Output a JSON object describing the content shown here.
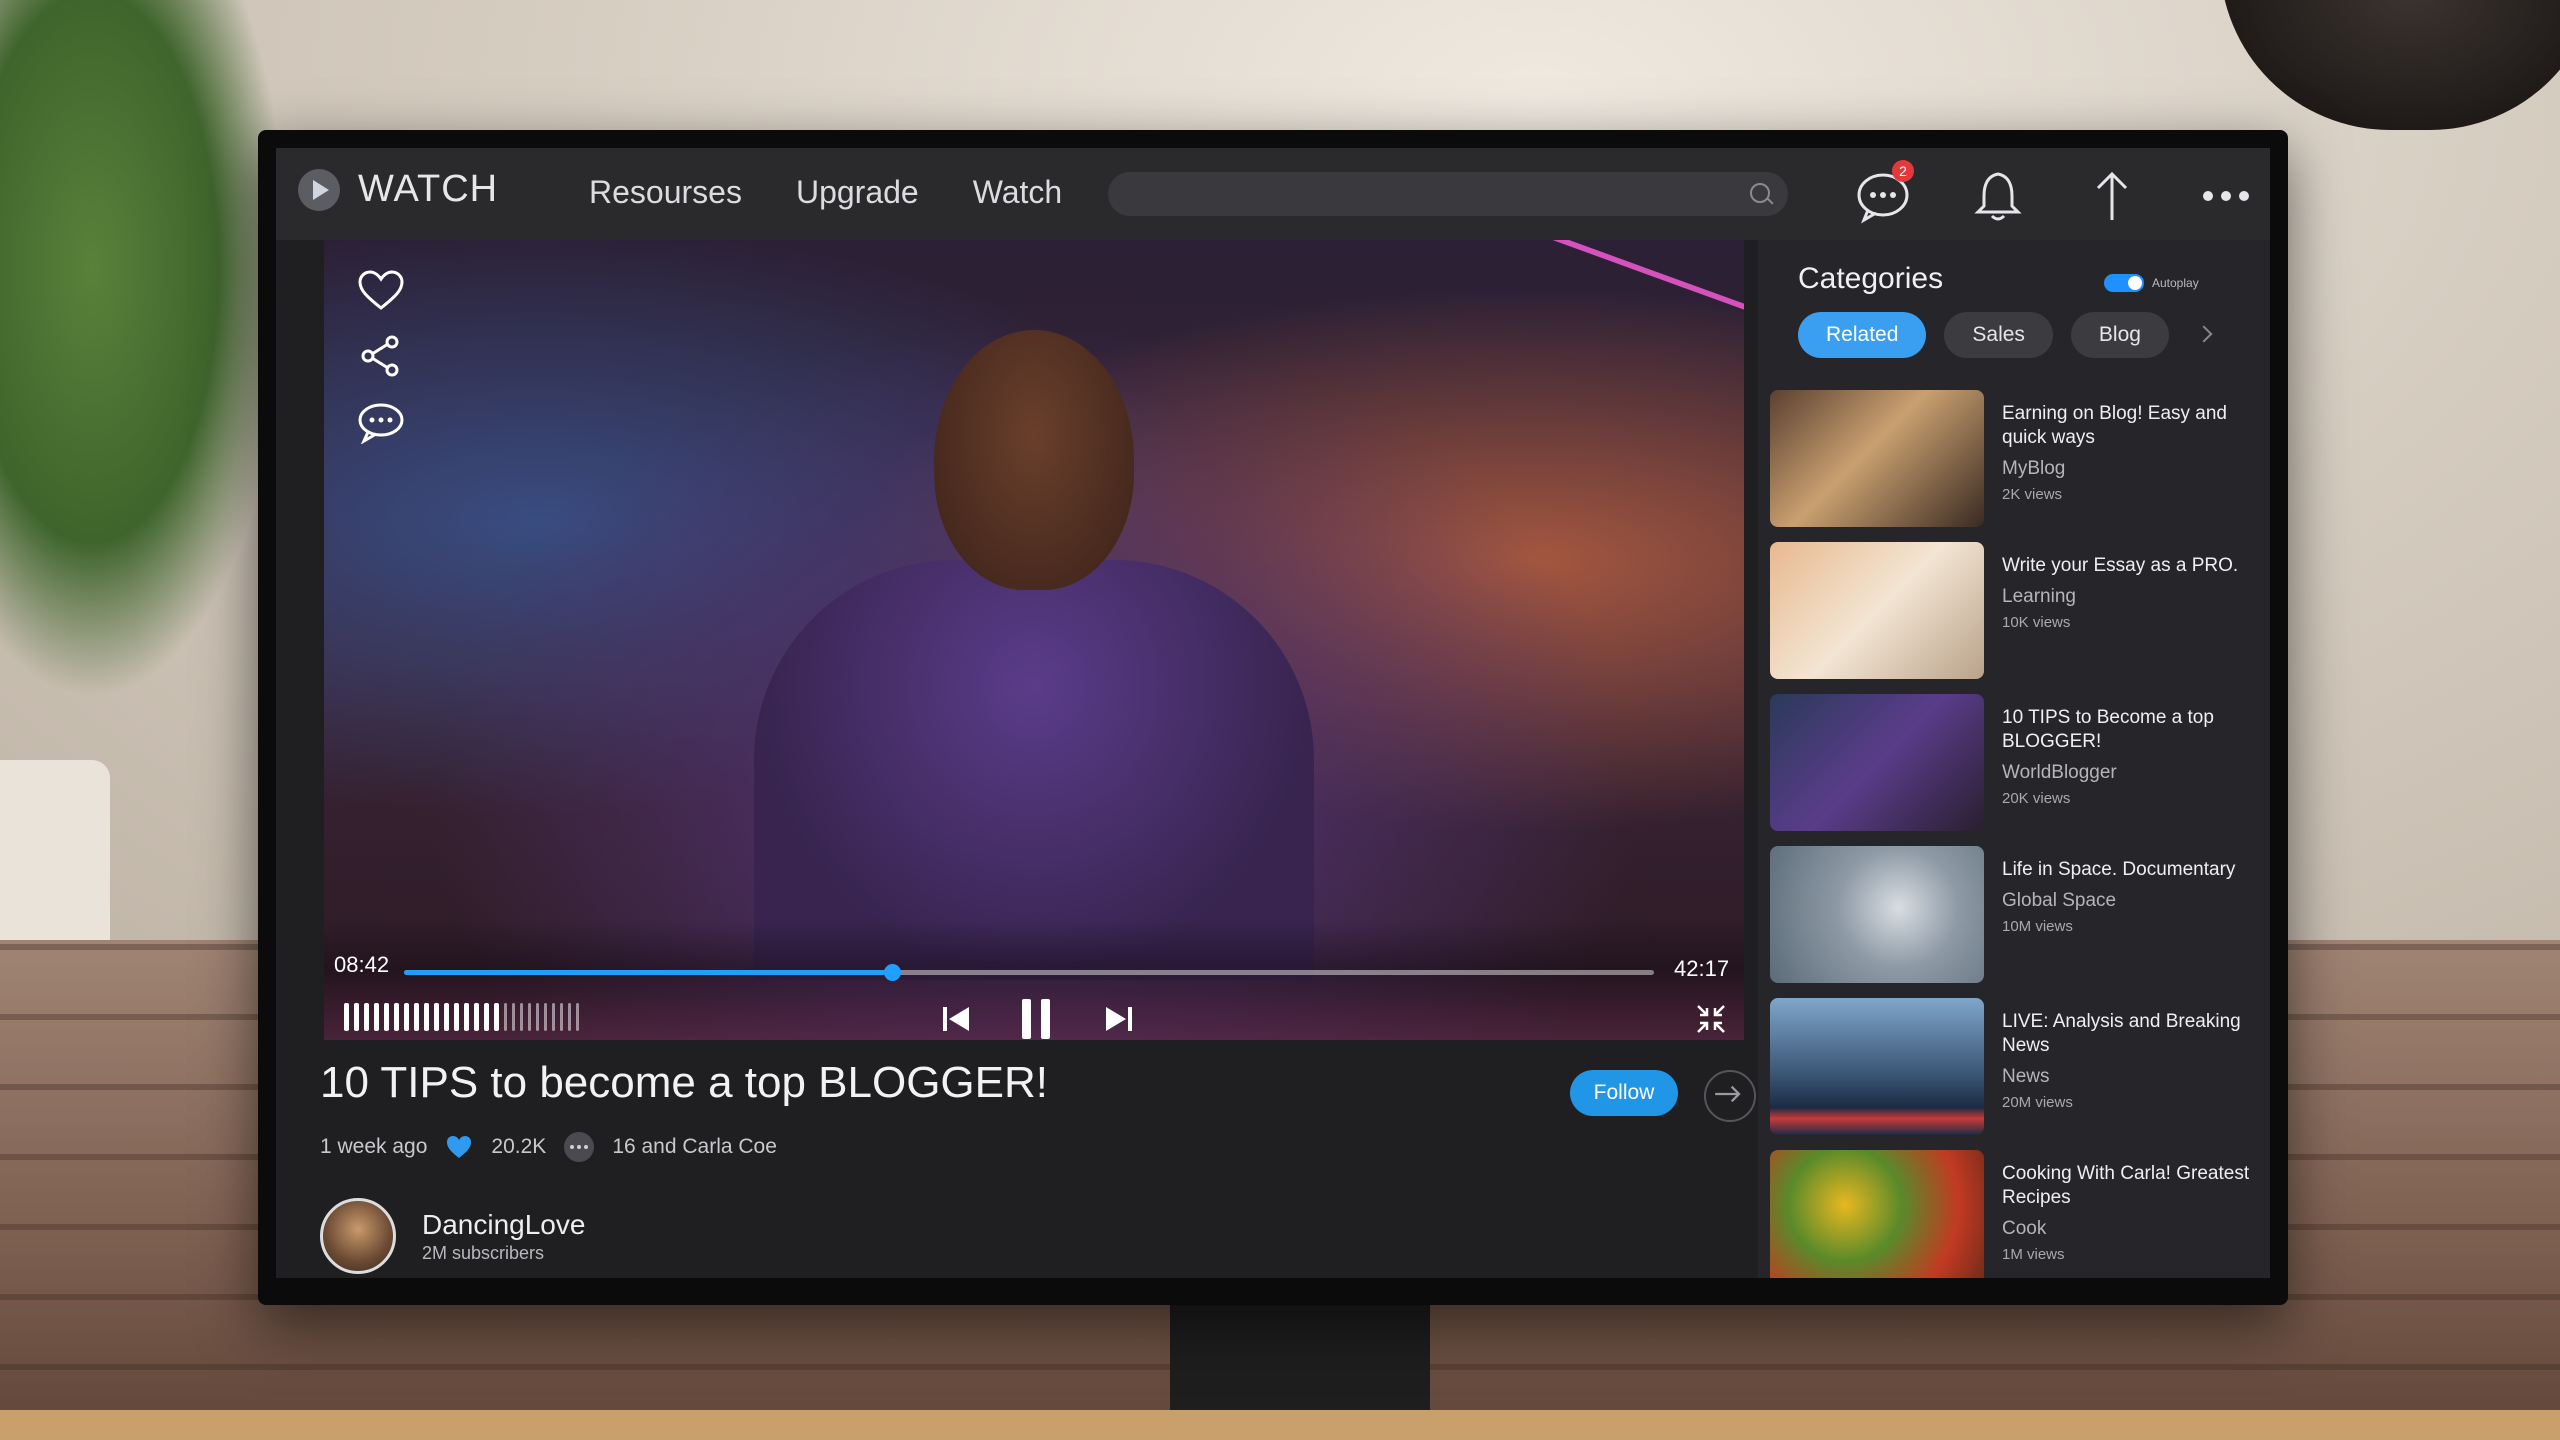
{
  "nav": {
    "logo": "WATCH",
    "menu": [
      "Resourses",
      "Upgrade",
      "Watch"
    ],
    "search_placeholder": "",
    "chat_badge": "2",
    "accent": "#1ea0ff"
  },
  "player": {
    "elapsed": "08:42",
    "duration": "42:17",
    "progress": 0.39,
    "volume_level": 0.6
  },
  "video": {
    "title": "10 TIPS to become a top BLOGGER!",
    "age": "1 week ago",
    "likes": "20.2K",
    "comments_text": "16 and Carla Coe",
    "follow_label": "Follow"
  },
  "channel": {
    "name": "DancingLove",
    "subscribers": "2M subscribers"
  },
  "sidebar": {
    "title": "Categories",
    "autoplay_label": "Autoplay",
    "chips": [
      "Related",
      "Sales",
      "Blog"
    ],
    "items": [
      {
        "title": "Earning on Blog! Easy and quick ways",
        "channel": "MyBlog",
        "views": "2K views"
      },
      {
        "title": "Write your Essay as a PRO.",
        "channel": "Learning",
        "views": "10K views"
      },
      {
        "title": "10 TIPS to Become a top BLOGGER!",
        "channel": "WorldBlogger",
        "views": "20K views"
      },
      {
        "title": "Life in Space. Documentary",
        "channel": "Global Space",
        "views": "10M views"
      },
      {
        "title": "LIVE: Analysis and Breaking News",
        "channel": "News",
        "views": "20M views"
      },
      {
        "title": "Cooking With Carla! Greatest Recipes",
        "channel": "Cook",
        "views": "1M views"
      }
    ]
  }
}
